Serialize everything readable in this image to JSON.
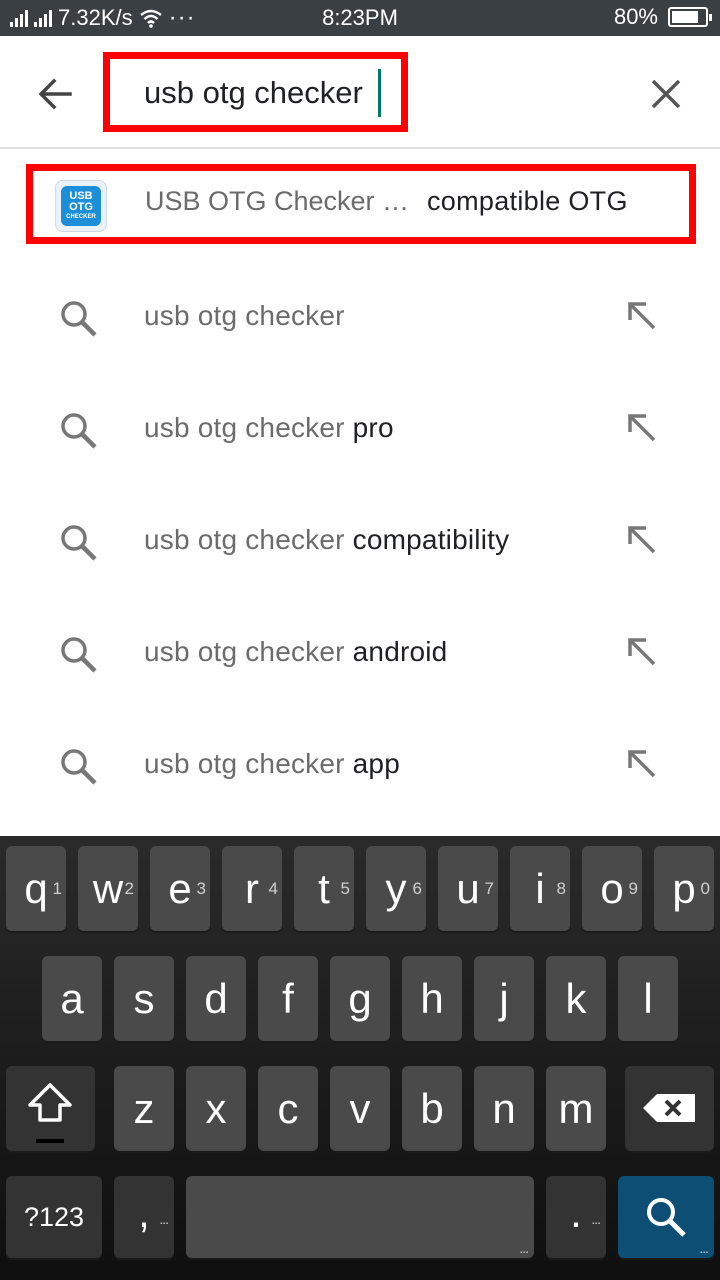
{
  "status_bar": {
    "network_speed": "7.32K/s",
    "dots": "···",
    "time": "8:23PM",
    "battery_percent": "80%",
    "battery_level": 0.8
  },
  "search": {
    "query": "usb otg checker",
    "back_icon": "arrow-back-icon",
    "clear_icon": "close-icon"
  },
  "app_suggestion": {
    "icon_text_line1": "USB",
    "icon_text_line2": "OTG",
    "icon_text_line3": "CHECKER",
    "name": "USB OTG Checker …",
    "extra": "compatible OTG"
  },
  "suggestions": [
    {
      "prefix": "usb otg checker",
      "suffix": ""
    },
    {
      "prefix": "usb otg checker",
      "suffix": " pro"
    },
    {
      "prefix": "usb otg checker",
      "suffix": " compatibility"
    },
    {
      "prefix": "usb otg checker",
      "suffix": " android"
    },
    {
      "prefix": "usb otg checker",
      "suffix": " app"
    }
  ],
  "keyboard": {
    "row1": [
      {
        "label": "q",
        "hint": "1"
      },
      {
        "label": "w",
        "hint": "2"
      },
      {
        "label": "e",
        "hint": "3"
      },
      {
        "label": "r",
        "hint": "4"
      },
      {
        "label": "t",
        "hint": "5"
      },
      {
        "label": "y",
        "hint": "6"
      },
      {
        "label": "u",
        "hint": "7"
      },
      {
        "label": "i",
        "hint": "8"
      },
      {
        "label": "o",
        "hint": "9"
      },
      {
        "label": "p",
        "hint": "0"
      }
    ],
    "row2": [
      "a",
      "s",
      "d",
      "f",
      "g",
      "h",
      "j",
      "k",
      "l"
    ],
    "row3": [
      "z",
      "x",
      "c",
      "v",
      "b",
      "n",
      "m"
    ],
    "symbols_label": "?123",
    "comma_label": ",",
    "period_label": ".",
    "more_dots": "..."
  },
  "colors": {
    "highlight_border": "#ff0000",
    "cursor": "#00796b",
    "search_key": "#0d4f74"
  }
}
